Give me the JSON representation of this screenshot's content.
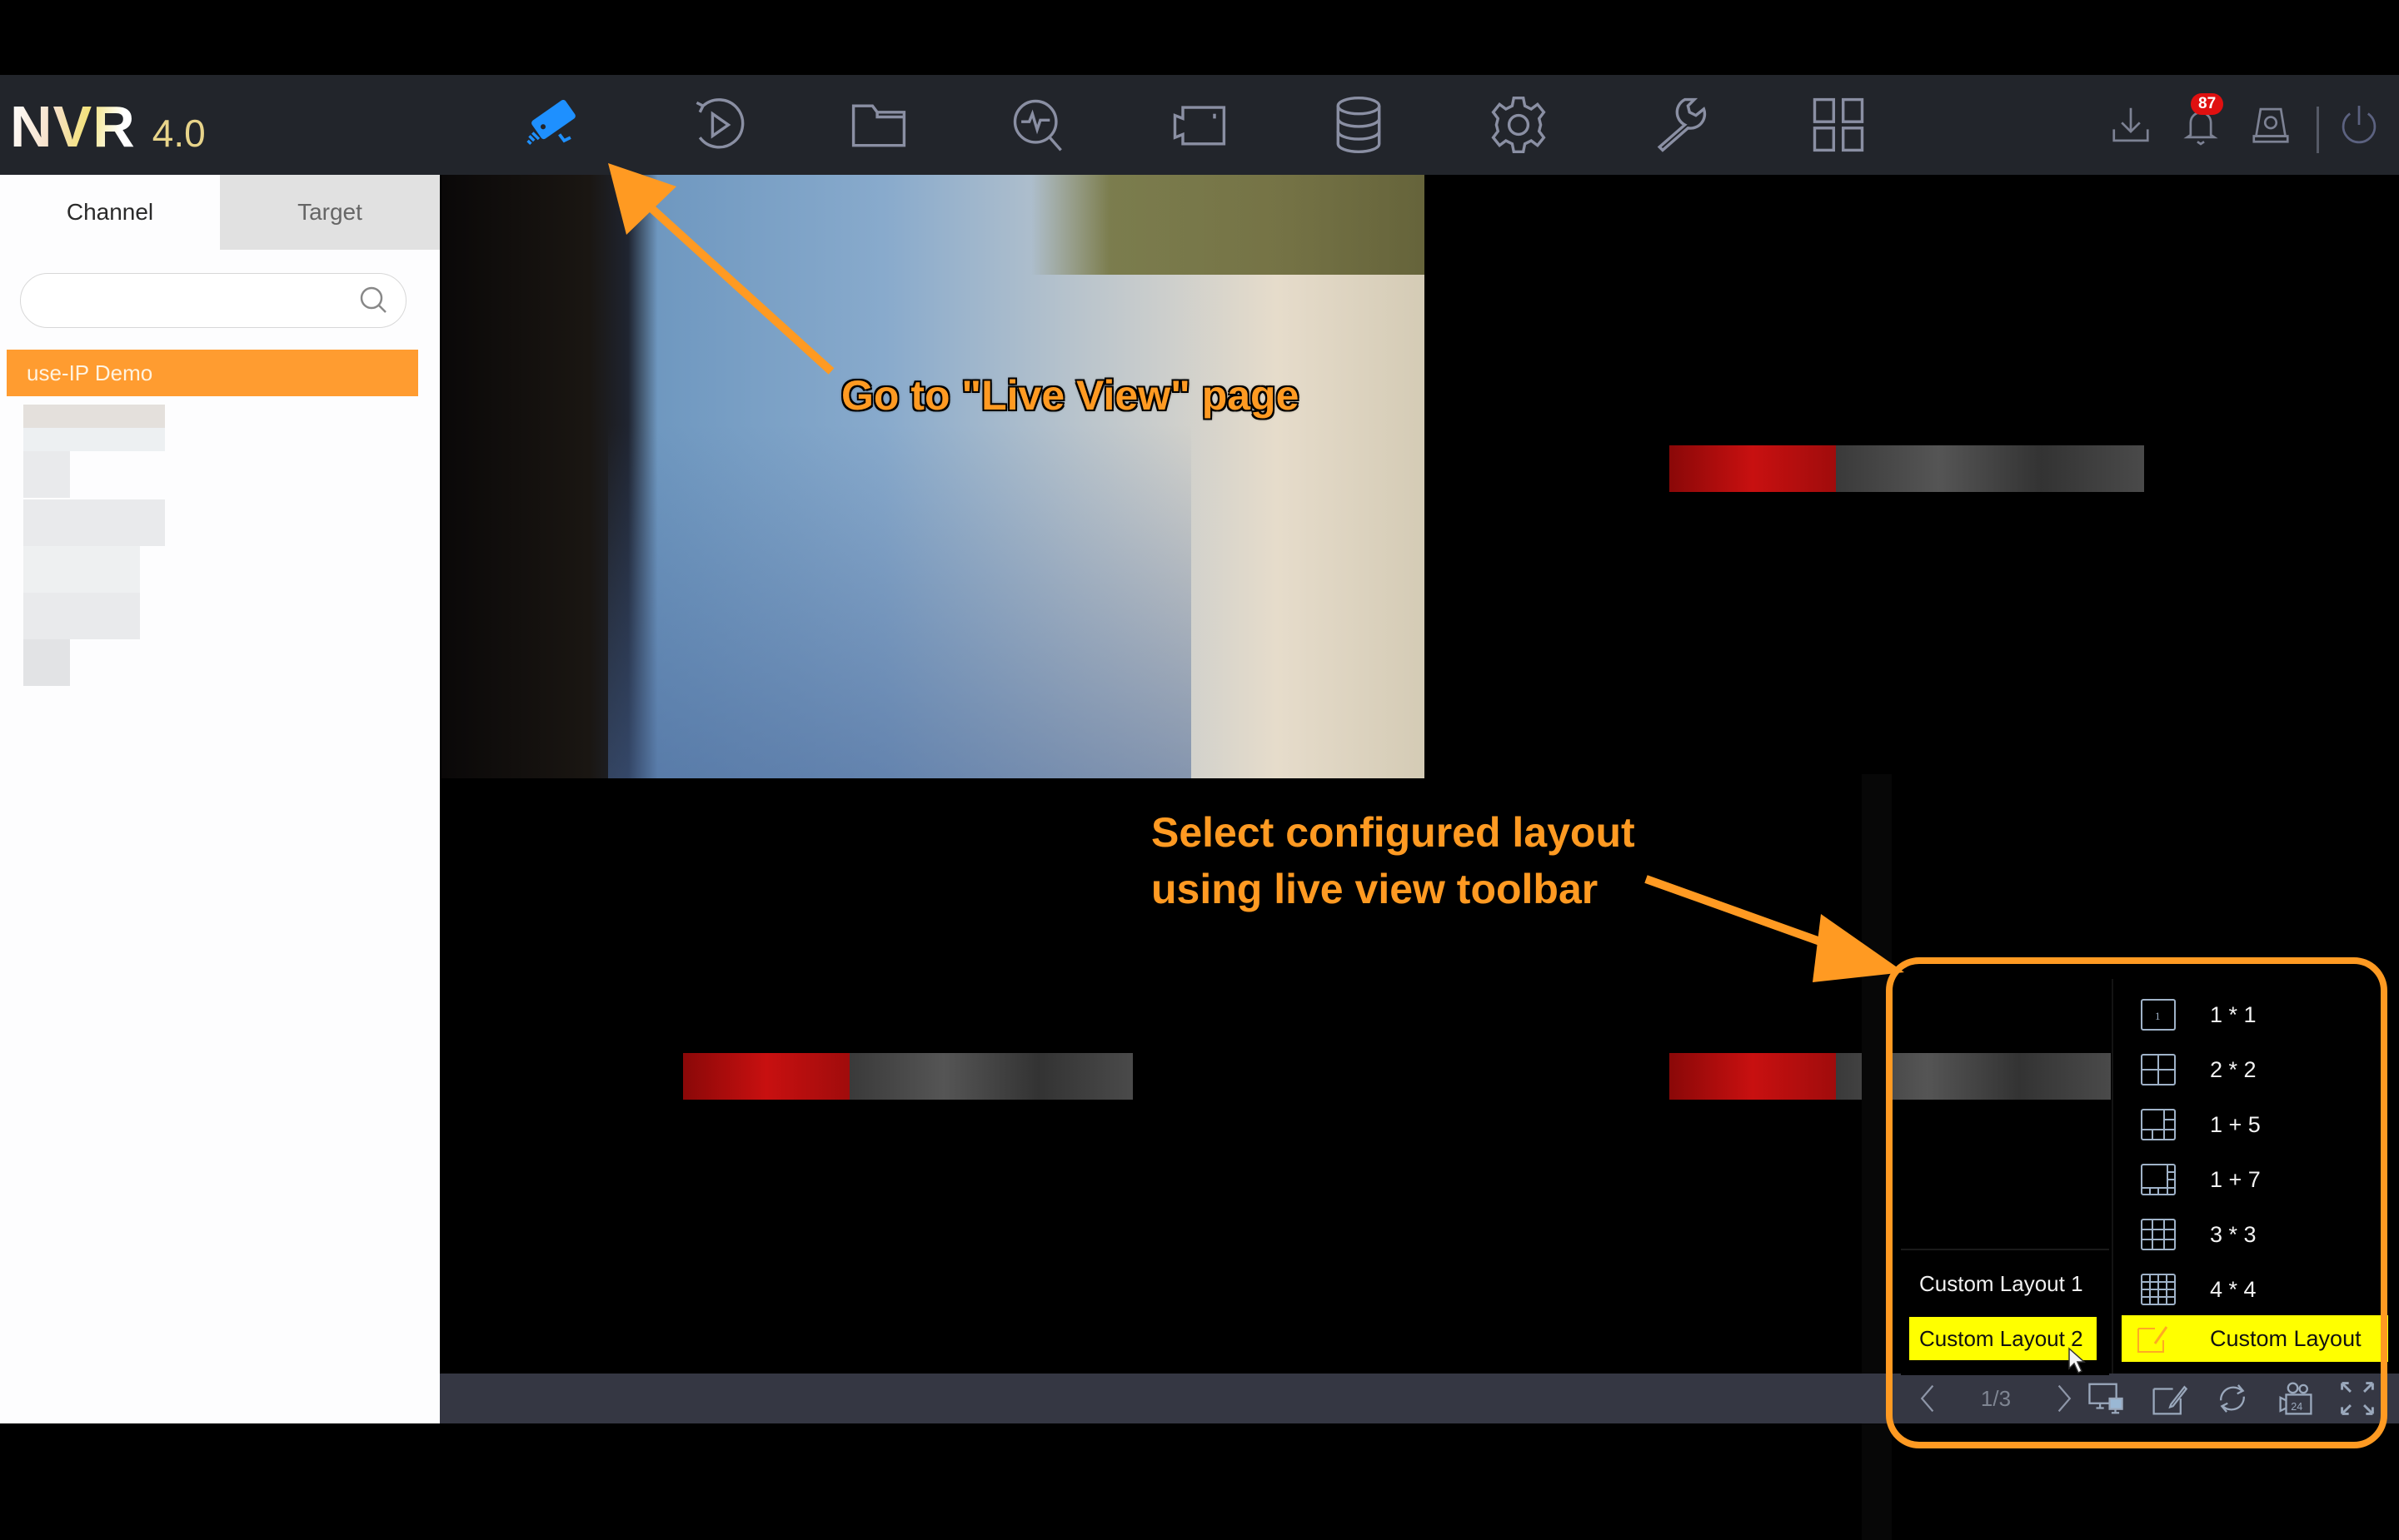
{
  "app": {
    "logo_main": "NVR",
    "logo_version": "4.0"
  },
  "header": {
    "nav_icons": [
      {
        "name": "live-view-icon",
        "active": true
      },
      {
        "name": "playback-icon",
        "active": false
      },
      {
        "name": "file-management-icon",
        "active": false
      },
      {
        "name": "smart-search-icon",
        "active": false
      },
      {
        "name": "camera-icon",
        "active": false
      },
      {
        "name": "storage-icon",
        "active": false
      },
      {
        "name": "settings-gear-icon",
        "active": false
      },
      {
        "name": "maintenance-wrench-icon",
        "active": false
      },
      {
        "name": "apps-grid-icon",
        "active": false
      }
    ],
    "right_icons": [
      "download-icon",
      "notification-bell-icon",
      "alarm-light-icon",
      "power-icon"
    ],
    "notification_count": "87",
    "active_color": "#1e90ff",
    "icon_color": "#8a8fa3"
  },
  "sidebar": {
    "tabs": [
      {
        "label": "Channel",
        "active": true
      },
      {
        "label": "Target",
        "active": false
      }
    ],
    "search": {
      "value": "",
      "placeholder": ""
    },
    "selected_channel": "use-IP Demo",
    "selected_color": "#ff9c30"
  },
  "layout_menu": {
    "custom_layouts": [
      {
        "label": "Custom Layout 1",
        "selected": false
      },
      {
        "label": "Custom Layout 2",
        "selected": true
      }
    ],
    "presets": [
      {
        "label": "1 * 1",
        "icon": "layout-1x1-icon"
      },
      {
        "label": "2 * 2",
        "icon": "layout-2x2-icon"
      },
      {
        "label": "1 + 5",
        "icon": "layout-1plus5-icon"
      },
      {
        "label": "1 + 7",
        "icon": "layout-1plus7-icon"
      },
      {
        "label": "3 * 3",
        "icon": "layout-3x3-icon"
      },
      {
        "label": "4 * 4",
        "icon": "layout-4x4-icon"
      }
    ],
    "custom_entry": {
      "label": "Custom Layout",
      "selected": true
    },
    "highlight_color": "#ffff00"
  },
  "toolbar": {
    "page_indicator": "1/3",
    "buttons": [
      "prev-page-icon",
      "next-page-icon",
      "layout-screen-icon",
      "edit-layout-icon",
      "sequence-icon",
      "record-24-icon",
      "fullscreen-icon"
    ],
    "record_label": "24"
  },
  "annotations": {
    "step1": "Go to \"Live View\" page",
    "step2_line1": "Select configured layout",
    "step2_line2": "using live view toolbar",
    "color": "#ff9a22"
  }
}
